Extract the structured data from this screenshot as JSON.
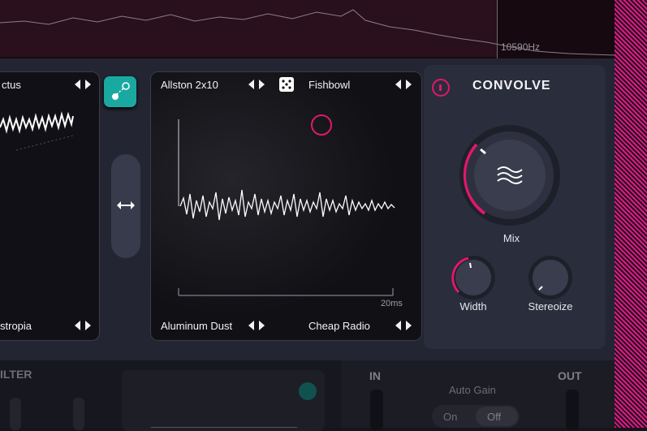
{
  "top": {
    "freq_label": "10590Hz"
  },
  "left_panel": {
    "top_name": "ctus",
    "bottom_name": "stropia"
  },
  "convolve": {
    "title": "CONVOLVE",
    "ir_a_top": "Allston 2x10",
    "ir_b_top": "Fishbowl",
    "ir_a_bottom": "Aluminum Dust",
    "ir_b_bottom": "Cheap Radio",
    "time_label": "20ms",
    "mix_label": "Mix",
    "width_label": "Width",
    "stereoize_label": "Stereoize",
    "mix_value": 0.25,
    "width_value": 0.15,
    "stereoize_value": 0.0
  },
  "bottom": {
    "filter_label": "ILTER",
    "in_label": "IN",
    "out_label": "OUT",
    "auto_gain_label": "Auto Gain",
    "on_label": "On",
    "off_label": "Off"
  },
  "colors": {
    "accent": "#e0186c",
    "teal": "#1aa9a0",
    "panel": "#2a2d3c"
  }
}
